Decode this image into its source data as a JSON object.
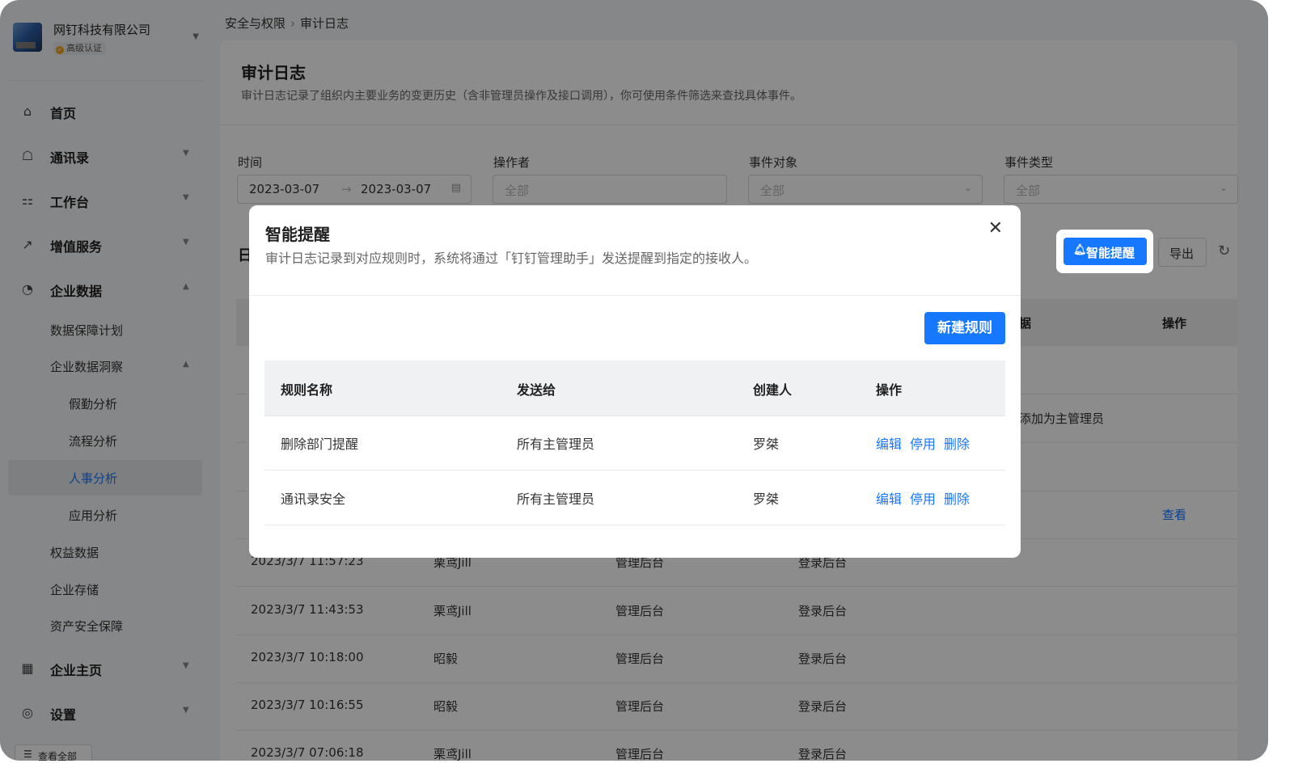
{
  "org": {
    "name": "网钉科技有限公司",
    "badge": "高级认证"
  },
  "sidebar": {
    "items": [
      {
        "label": "首页"
      },
      {
        "label": "通讯录"
      },
      {
        "label": "工作台"
      },
      {
        "label": "增值服务"
      },
      {
        "label": "企业数据"
      }
    ],
    "sub": [
      "数据保障计划",
      "企业数据洞察",
      "假勤分析",
      "流程分析",
      "人事分析",
      "应用分析",
      "权益数据",
      "企业存储",
      "资产安全保障"
    ],
    "bottom": [
      {
        "label": "企业主页"
      },
      {
        "label": "设置"
      }
    ],
    "view_all": "查看全部"
  },
  "breadcrumb": {
    "parent": "安全与权限",
    "current": "审计日志"
  },
  "page": {
    "title": "审计日志",
    "desc": "审计日志记录了组织内主要业务的变更历史（含非管理员操作及接口调用），你可使用条件筛选来查找具体事件。"
  },
  "filters": {
    "time_label": "时间",
    "date_start": "2023-03-07",
    "date_end": "2023-03-07",
    "operator_label": "操作者",
    "operator_value": "全部",
    "object_label": "事件对象",
    "object_value": "全部",
    "type_label": "事件类型",
    "type_value": "全部"
  },
  "log_section_title": "日",
  "toolbar": {
    "smart": "智能提醒",
    "export": "导出"
  },
  "table": {
    "col_data_tail": "据",
    "col_action": "操作",
    "row_partial_text": "添加为主管理员",
    "row_link": "查看",
    "rows": [
      {
        "time": "2023/3/7 11:57:23",
        "user": "栗鸢Jill",
        "platform": "管理后台",
        "event": "登录后台"
      },
      {
        "time": "2023/3/7 11:43:53",
        "user": "栗鸢Jill",
        "platform": "管理后台",
        "event": "登录后台"
      },
      {
        "time": "2023/3/7 10:18:00",
        "user": "昭毅",
        "platform": "管理后台",
        "event": "登录后台"
      },
      {
        "time": "2023/3/7 10:16:55",
        "user": "昭毅",
        "platform": "管理后台",
        "event": "登录后台"
      },
      {
        "time": "2023/3/7 07:06:18",
        "user": "栗鸢Jill",
        "platform": "管理后台",
        "event": "登录后台"
      }
    ]
  },
  "modal": {
    "title": "智能提醒",
    "desc": "审计日志记录到对应规则时，系统将通过「钉钉管理助手」发送提醒到指定的接收人。",
    "new_rule": "新建规则",
    "headers": {
      "name": "规则名称",
      "send_to": "发送给",
      "creator": "创建人",
      "action": "操作"
    },
    "rows": [
      {
        "name": "删除部门提醒",
        "send_to": "所有主管理员",
        "creator": "罗桀",
        "edit": "编辑",
        "disable": "停用",
        "delete": "删除"
      },
      {
        "name": "通讯录安全",
        "send_to": "所有主管理员",
        "creator": "罗桀",
        "edit": "编辑",
        "disable": "停用",
        "delete": "删除"
      }
    ]
  },
  "colors": {
    "accent": "#1677ff"
  }
}
